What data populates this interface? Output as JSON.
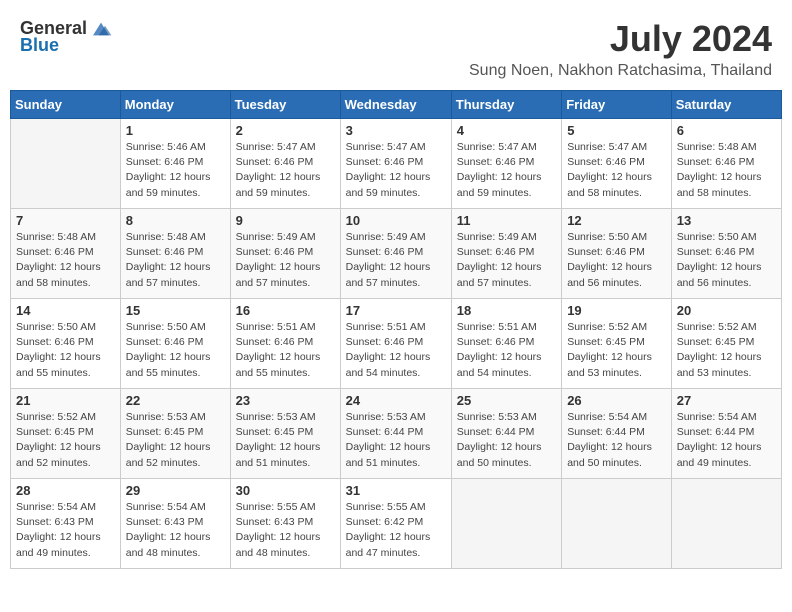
{
  "logo": {
    "text_general": "General",
    "text_blue": "Blue"
  },
  "title": {
    "month_year": "July 2024",
    "location": "Sung Noen, Nakhon Ratchasima, Thailand"
  },
  "days_of_week": [
    "Sunday",
    "Monday",
    "Tuesday",
    "Wednesday",
    "Thursday",
    "Friday",
    "Saturday"
  ],
  "weeks": [
    [
      {
        "day": "",
        "info": ""
      },
      {
        "day": "1",
        "info": "Sunrise: 5:46 AM\nSunset: 6:46 PM\nDaylight: 12 hours\nand 59 minutes."
      },
      {
        "day": "2",
        "info": "Sunrise: 5:47 AM\nSunset: 6:46 PM\nDaylight: 12 hours\nand 59 minutes."
      },
      {
        "day": "3",
        "info": "Sunrise: 5:47 AM\nSunset: 6:46 PM\nDaylight: 12 hours\nand 59 minutes."
      },
      {
        "day": "4",
        "info": "Sunrise: 5:47 AM\nSunset: 6:46 PM\nDaylight: 12 hours\nand 59 minutes."
      },
      {
        "day": "5",
        "info": "Sunrise: 5:47 AM\nSunset: 6:46 PM\nDaylight: 12 hours\nand 58 minutes."
      },
      {
        "day": "6",
        "info": "Sunrise: 5:48 AM\nSunset: 6:46 PM\nDaylight: 12 hours\nand 58 minutes."
      }
    ],
    [
      {
        "day": "7",
        "info": "Sunrise: 5:48 AM\nSunset: 6:46 PM\nDaylight: 12 hours\nand 58 minutes."
      },
      {
        "day": "8",
        "info": "Sunrise: 5:48 AM\nSunset: 6:46 PM\nDaylight: 12 hours\nand 57 minutes."
      },
      {
        "day": "9",
        "info": "Sunrise: 5:49 AM\nSunset: 6:46 PM\nDaylight: 12 hours\nand 57 minutes."
      },
      {
        "day": "10",
        "info": "Sunrise: 5:49 AM\nSunset: 6:46 PM\nDaylight: 12 hours\nand 57 minutes."
      },
      {
        "day": "11",
        "info": "Sunrise: 5:49 AM\nSunset: 6:46 PM\nDaylight: 12 hours\nand 57 minutes."
      },
      {
        "day": "12",
        "info": "Sunrise: 5:50 AM\nSunset: 6:46 PM\nDaylight: 12 hours\nand 56 minutes."
      },
      {
        "day": "13",
        "info": "Sunrise: 5:50 AM\nSunset: 6:46 PM\nDaylight: 12 hours\nand 56 minutes."
      }
    ],
    [
      {
        "day": "14",
        "info": "Sunrise: 5:50 AM\nSunset: 6:46 PM\nDaylight: 12 hours\nand 55 minutes."
      },
      {
        "day": "15",
        "info": "Sunrise: 5:50 AM\nSunset: 6:46 PM\nDaylight: 12 hours\nand 55 minutes."
      },
      {
        "day": "16",
        "info": "Sunrise: 5:51 AM\nSunset: 6:46 PM\nDaylight: 12 hours\nand 55 minutes."
      },
      {
        "day": "17",
        "info": "Sunrise: 5:51 AM\nSunset: 6:46 PM\nDaylight: 12 hours\nand 54 minutes."
      },
      {
        "day": "18",
        "info": "Sunrise: 5:51 AM\nSunset: 6:46 PM\nDaylight: 12 hours\nand 54 minutes."
      },
      {
        "day": "19",
        "info": "Sunrise: 5:52 AM\nSunset: 6:45 PM\nDaylight: 12 hours\nand 53 minutes."
      },
      {
        "day": "20",
        "info": "Sunrise: 5:52 AM\nSunset: 6:45 PM\nDaylight: 12 hours\nand 53 minutes."
      }
    ],
    [
      {
        "day": "21",
        "info": "Sunrise: 5:52 AM\nSunset: 6:45 PM\nDaylight: 12 hours\nand 52 minutes."
      },
      {
        "day": "22",
        "info": "Sunrise: 5:53 AM\nSunset: 6:45 PM\nDaylight: 12 hours\nand 52 minutes."
      },
      {
        "day": "23",
        "info": "Sunrise: 5:53 AM\nSunset: 6:45 PM\nDaylight: 12 hours\nand 51 minutes."
      },
      {
        "day": "24",
        "info": "Sunrise: 5:53 AM\nSunset: 6:44 PM\nDaylight: 12 hours\nand 51 minutes."
      },
      {
        "day": "25",
        "info": "Sunrise: 5:53 AM\nSunset: 6:44 PM\nDaylight: 12 hours\nand 50 minutes."
      },
      {
        "day": "26",
        "info": "Sunrise: 5:54 AM\nSunset: 6:44 PM\nDaylight: 12 hours\nand 50 minutes."
      },
      {
        "day": "27",
        "info": "Sunrise: 5:54 AM\nSunset: 6:44 PM\nDaylight: 12 hours\nand 49 minutes."
      }
    ],
    [
      {
        "day": "28",
        "info": "Sunrise: 5:54 AM\nSunset: 6:43 PM\nDaylight: 12 hours\nand 49 minutes."
      },
      {
        "day": "29",
        "info": "Sunrise: 5:54 AM\nSunset: 6:43 PM\nDaylight: 12 hours\nand 48 minutes."
      },
      {
        "day": "30",
        "info": "Sunrise: 5:55 AM\nSunset: 6:43 PM\nDaylight: 12 hours\nand 48 minutes."
      },
      {
        "day": "31",
        "info": "Sunrise: 5:55 AM\nSunset: 6:42 PM\nDaylight: 12 hours\nand 47 minutes."
      },
      {
        "day": "",
        "info": ""
      },
      {
        "day": "",
        "info": ""
      },
      {
        "day": "",
        "info": ""
      }
    ]
  ]
}
